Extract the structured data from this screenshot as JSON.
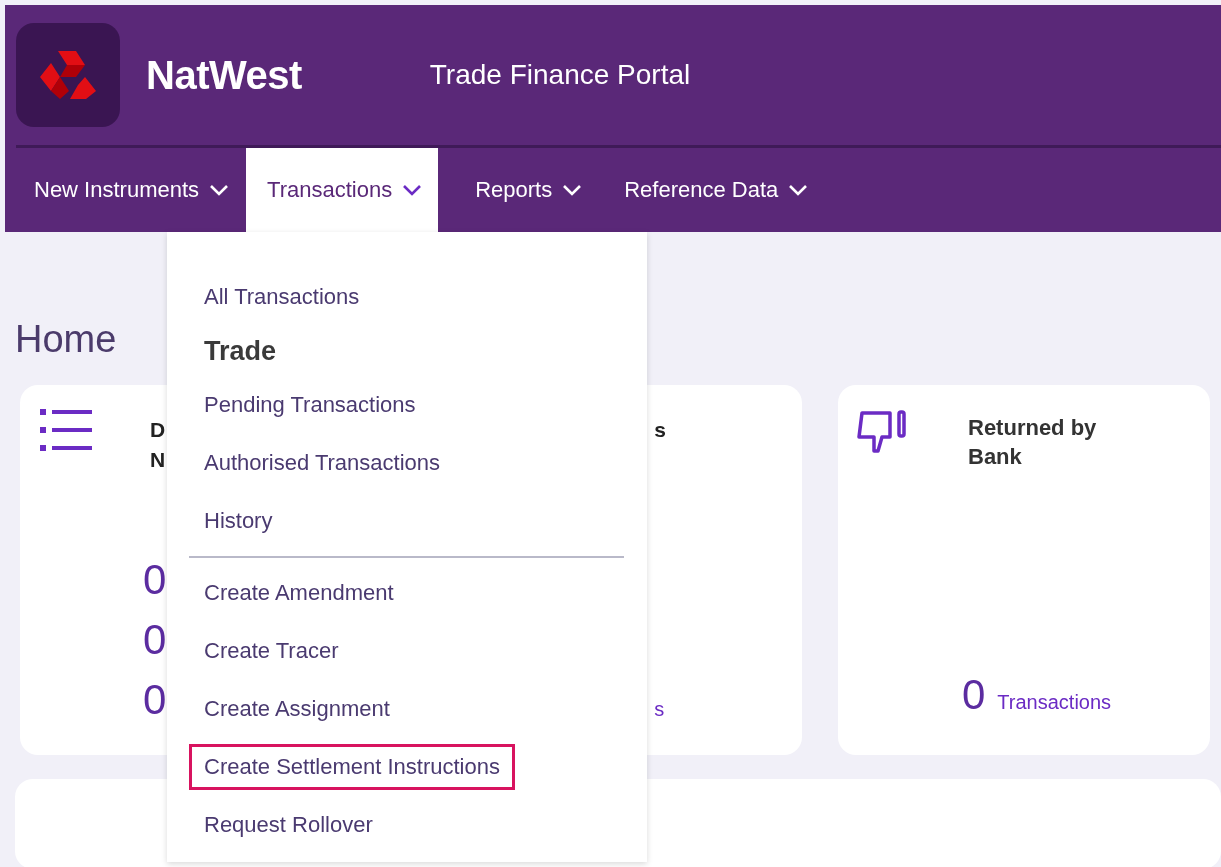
{
  "header": {
    "brand": "NatWest",
    "title": "Trade Finance Portal"
  },
  "nav": [
    {
      "label": "New Instruments",
      "selected": false
    },
    {
      "label": "Transactions",
      "selected": true
    },
    {
      "label": "Reports",
      "selected": false
    },
    {
      "label": "Reference Data",
      "selected": false
    }
  ],
  "dropdown": [
    {
      "kind": "link",
      "label": "All Transactions",
      "highlighted": false
    },
    {
      "kind": "heading",
      "label": "Trade"
    },
    {
      "kind": "link",
      "label": "Pending Transactions",
      "highlighted": false
    },
    {
      "kind": "link",
      "label": "Authorised Transactions",
      "highlighted": false
    },
    {
      "kind": "link",
      "label": "History",
      "highlighted": false
    },
    {
      "kind": "divider"
    },
    {
      "kind": "link",
      "label": "Create Amendment",
      "highlighted": false
    },
    {
      "kind": "link",
      "label": "Create Tracer",
      "highlighted": false
    },
    {
      "kind": "link",
      "label": "Create Assignment",
      "highlighted": false
    },
    {
      "kind": "link",
      "label": "Create Settlement Instructions",
      "highlighted": true
    },
    {
      "kind": "link",
      "label": "Request Rollover",
      "highlighted": false
    }
  ],
  "page_title": "Home",
  "summary_card": {
    "title_lines": [
      "D",
      "N"
    ],
    "counts": [
      "0",
      "0",
      "0"
    ],
    "side_title": "s",
    "side_link": "s"
  },
  "returned_card": {
    "title": "Returned by Bank",
    "count": "0",
    "link": "Transactions"
  }
}
